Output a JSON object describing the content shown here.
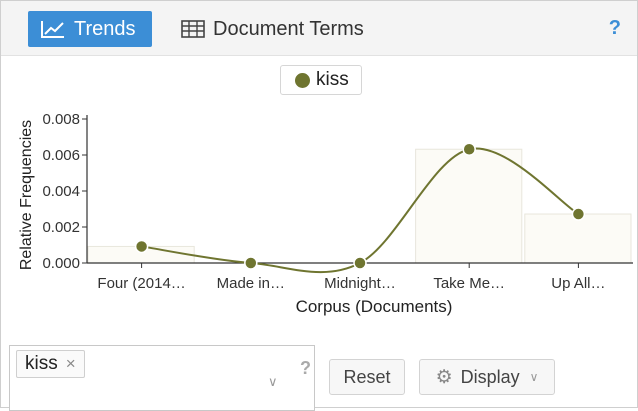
{
  "tabs": [
    {
      "label": "Trends",
      "icon": "line-chart-icon",
      "active": true
    },
    {
      "label": "Document Terms",
      "icon": "table-icon",
      "active": false
    }
  ],
  "help_label": "?",
  "legend": {
    "label": "kiss",
    "color": "#6f7530"
  },
  "chart_data": {
    "type": "line",
    "title": "",
    "xlabel": "Corpus (Documents)",
    "ylabel": "Relative Frequencies",
    "categories": [
      "Four (2014…",
      "Made in…",
      "Midnight…",
      "Take Me…",
      "Up All…"
    ],
    "series": [
      {
        "name": "kiss",
        "color": "#6f7530",
        "values": [
          0.00092,
          0.0,
          0.0,
          0.00632,
          0.00272
        ]
      }
    ],
    "ylim": [
      0,
      0.008
    ],
    "yticks": [
      "0.008",
      "0.006",
      "0.004",
      "0.002",
      "0.000"
    ],
    "ytick_values": [
      0.008,
      0.006,
      0.004,
      0.002,
      0.0
    ],
    "grid": false
  },
  "controls": {
    "selected_term": "kiss",
    "remove_icon": "×",
    "dropdown_icon": "chevron-down-icon",
    "help": "?",
    "reset_label": "Reset",
    "display_label": "Display"
  }
}
